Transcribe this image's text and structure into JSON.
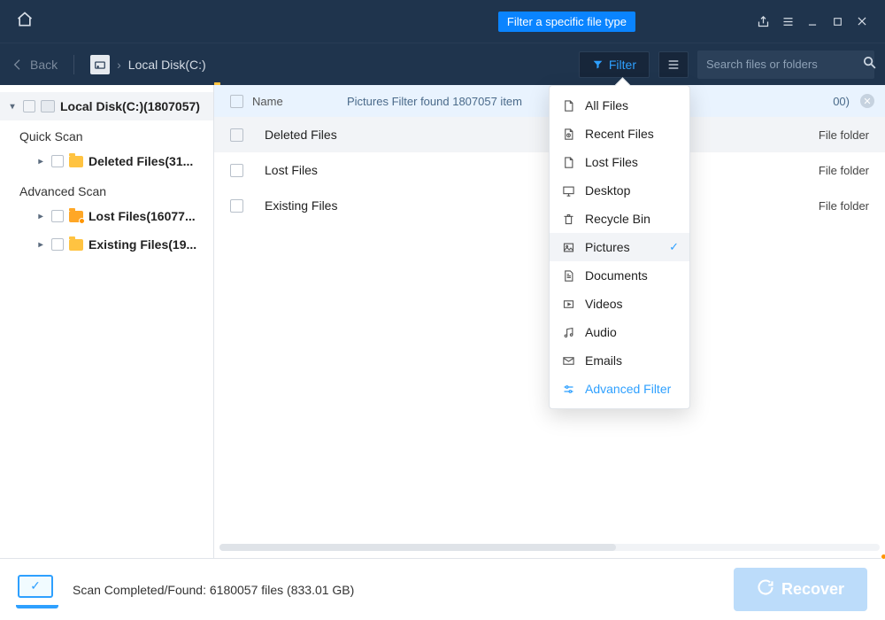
{
  "tooltip": "Filter a specific file type",
  "toolbar": {
    "back": "Back",
    "crumb": "Local Disk(C:)",
    "filter_label": "Filter",
    "search_placeholder": "Search files or folders"
  },
  "sidebar": {
    "root": "Local Disk(C:)(1807057)",
    "quick_heading": "Quick Scan",
    "advanced_heading": "Advanced Scan",
    "quick_items": [
      {
        "label": "Deleted Files(31..."
      }
    ],
    "adv_items": [
      {
        "label": "Lost Files(16077..."
      },
      {
        "label": "Existing Files(19..."
      }
    ]
  },
  "header": {
    "name_col": "Name",
    "notice": "Pictures Filter found 1807057 item",
    "type_trail": "00)"
  },
  "rows": [
    {
      "name": "Deleted Files",
      "type": "File folder",
      "selected": true,
      "variant": "orange"
    },
    {
      "name": "Lost Files",
      "type": "File folder",
      "selected": false,
      "variant": "orange-dot"
    },
    {
      "name": "Existing Files",
      "type": "File folder",
      "selected": false,
      "variant": "yellow"
    }
  ],
  "filter_menu": {
    "items": [
      {
        "label": "All Files",
        "icon": "file"
      },
      {
        "label": "Recent Files",
        "icon": "clock"
      },
      {
        "label": "Lost Files",
        "icon": "file"
      },
      {
        "label": "Desktop",
        "icon": "desktop"
      },
      {
        "label": "Recycle Bin",
        "icon": "trash"
      },
      {
        "label": "Pictures",
        "icon": "image",
        "active": true
      },
      {
        "label": "Documents",
        "icon": "doc"
      },
      {
        "label": "Videos",
        "icon": "video"
      },
      {
        "label": "Audio",
        "icon": "audio"
      },
      {
        "label": "Emails",
        "icon": "mail"
      }
    ],
    "advanced": "Advanced Filter"
  },
  "status": {
    "text": "Scan Completed/Found: 6180057 files (833.01 GB)",
    "recover": "Recover"
  }
}
